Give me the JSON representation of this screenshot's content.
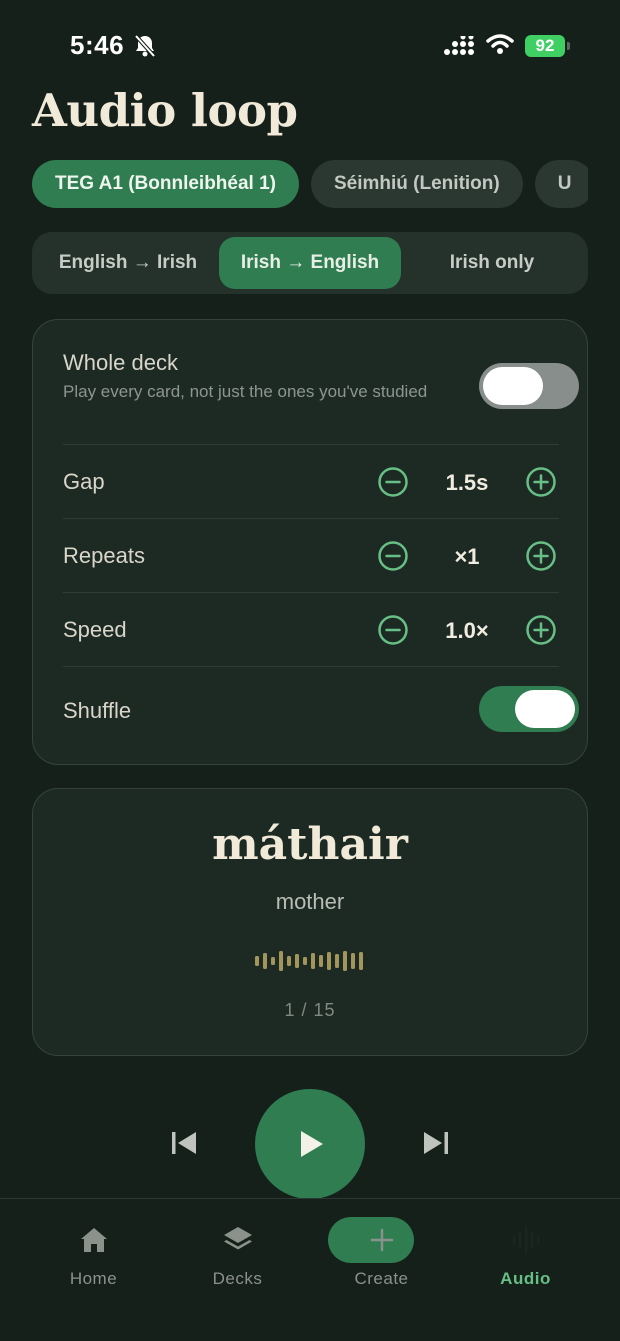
{
  "status_bar": {
    "time": "5:46",
    "battery": "92"
  },
  "title": "Audio loop",
  "decks": [
    {
      "label": "TEG A1 (Bonnleibhéal 1)",
      "active": true
    },
    {
      "label": "Séimhiú (Lenition)",
      "active": false
    },
    {
      "label": "U",
      "active": false
    }
  ],
  "directions": [
    {
      "label": "English → Irish",
      "active": false
    },
    {
      "label": "Irish → English",
      "active": true
    },
    {
      "label": "Irish only",
      "active": false
    }
  ],
  "settings": {
    "whole_deck": {
      "label": "Whole deck",
      "sub": "Play every card, not just the ones you've studied",
      "on": false
    },
    "gap": {
      "label": "Gap",
      "value": "1.5s"
    },
    "repeats": {
      "label": "Repeats",
      "value": "×1"
    },
    "speed": {
      "label": "Speed",
      "value": "1.0×"
    },
    "shuffle": {
      "label": "Shuffle",
      "on": true
    }
  },
  "card": {
    "word": "máthair",
    "translation": "mother",
    "counter": "1 / 15"
  },
  "tabs": [
    {
      "label": "Home",
      "icon": "home-icon",
      "active": false
    },
    {
      "label": "Decks",
      "icon": "layers-icon",
      "active": false
    },
    {
      "label": "Create",
      "icon": "plus-icon",
      "active": false
    },
    {
      "label": "Audio",
      "icon": "waveform-icon",
      "active": true
    }
  ],
  "colors": {
    "accent": "#2f7d51",
    "accent_light": "#67bf86",
    "background": "#15201b",
    "card": "#1d2a24",
    "wave": "#a3965a"
  }
}
